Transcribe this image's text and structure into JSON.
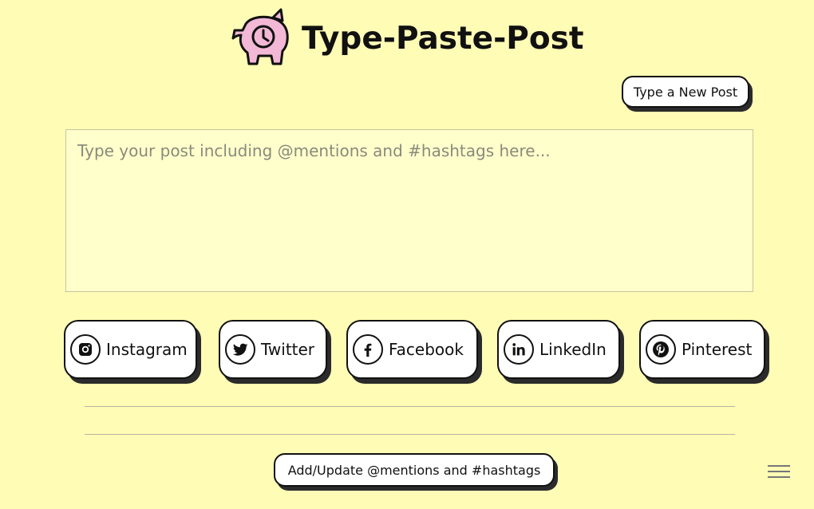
{
  "app": {
    "title": "Type-Paste-Post"
  },
  "toolbar": {
    "new_post_label": "Type a New Post"
  },
  "editor": {
    "placeholder": "Type your post including @mentions and #hashtags here...",
    "value": ""
  },
  "platforms": [
    {
      "label": "Instagram",
      "icon": "instagram-icon"
    },
    {
      "label": "Twitter",
      "icon": "twitter-icon"
    },
    {
      "label": "Facebook",
      "icon": "facebook-icon"
    },
    {
      "label": "LinkedIn",
      "icon": "linkedin-icon"
    },
    {
      "label": "Pinterest",
      "icon": "pinterest-icon"
    }
  ],
  "footer": {
    "tags_button_label": "Add/Update @mentions and #hashtags",
    "menu_icon": "hamburger-menu-icon"
  },
  "colors": {
    "background": "#fffcb6",
    "editor_background": "#ffffcc",
    "logo_pink": "#f2b8d6",
    "button_shadow": "#2b2b2b"
  }
}
